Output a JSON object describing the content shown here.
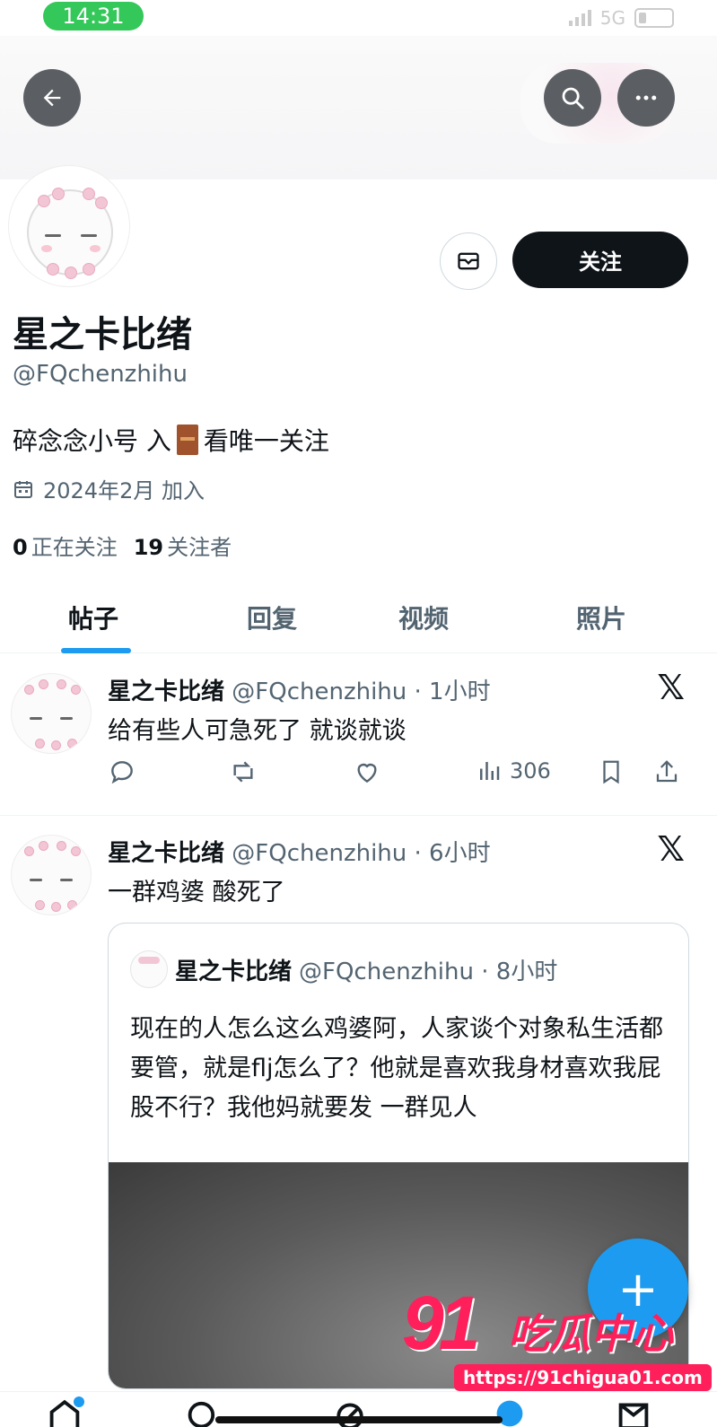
{
  "status_bar": {
    "time": "14:31",
    "network": "5G"
  },
  "profile": {
    "name": "星之卡比绪",
    "handle": "@FQchenzhihu",
    "bio_before": "碎念念小号 入",
    "bio_after": "看唯一关注",
    "joined": "2024年2月 加入",
    "following_count": "0",
    "following_label": "正在关注",
    "followers_count": "19",
    "followers_label": "关注者",
    "follow_button": "关注"
  },
  "tabs": [
    {
      "label": "帖子",
      "active": true
    },
    {
      "label": "回复",
      "active": false
    },
    {
      "label": "视频",
      "active": false
    },
    {
      "label": "照片",
      "active": false
    }
  ],
  "posts": [
    {
      "name": "星之卡比绪",
      "meta": "@FQchenzhihu · 1小时",
      "text": "给有些人可急死了 就谈就谈",
      "views": "306"
    },
    {
      "name": "星之卡比绪",
      "meta": "@FQchenzhihu · 6小时",
      "text": "一群鸡婆 酸死了",
      "quote": {
        "name": "星之卡比绪",
        "meta": "@FQchenzhihu · 8小时",
        "text": "现在的人怎么这么鸡婆阿，人家谈个对象私生活都要管，就是flj怎么了？他就是喜欢我身材喜欢我屁股不行？我他妈就要发 一群见人"
      }
    }
  ],
  "x_logo": "𝕏",
  "fab_label": "+",
  "watermark": {
    "number": "91",
    "text": "吃瓜中心",
    "url": "https://91chigua01.com"
  },
  "colors": {
    "accent": "#1d9bf0",
    "dark": "#0f1419",
    "muted": "#536471",
    "watermark": "#ff1f5a"
  }
}
